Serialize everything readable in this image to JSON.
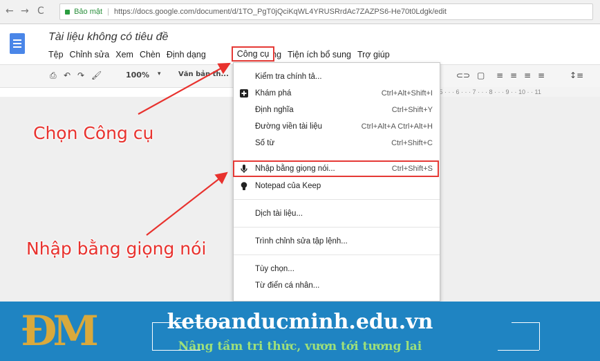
{
  "browser": {
    "security_label": "Bảo mật",
    "url": "https://docs.google.com/document/d/1TO_PgT0jQciKqWL4YRUSRrdAc7ZAZPS6-He70t0Ldgk/edit"
  },
  "doc": {
    "title": "Tài liệu không có tiêu đề"
  },
  "menubar": {
    "items": [
      "Tệp",
      "Chỉnh sửa",
      "Xem",
      "Chèn",
      "Định dạng",
      "Công cụ",
      "Bảng",
      "Tiện ích bổ sung",
      "Trợ giúp"
    ]
  },
  "toolbar": {
    "zoom": "100%",
    "style": "Văn bản th..."
  },
  "ruler": {
    "text": "· 5 · · · 6 · · · 7 · · · 8 · · · 9 · · 10 · · 11"
  },
  "tools_menu": {
    "items": [
      {
        "label": "Kiểm tra chính tả...",
        "shortcut": ""
      },
      {
        "label": "Khám phá",
        "shortcut": "Ctrl+Alt+Shift+I",
        "icon": "explore-icon"
      },
      {
        "label": "Định nghĩa",
        "shortcut": "Ctrl+Shift+Y"
      },
      {
        "label": "Đường viền tài liệu",
        "shortcut": "Ctrl+Alt+A Ctrl+Alt+H"
      },
      {
        "label": "Số từ",
        "shortcut": "Ctrl+Shift+C"
      },
      {
        "label": "Nhập bằng giọng nói...",
        "shortcut": "Ctrl+Shift+S",
        "icon": "microphone-icon"
      },
      {
        "label": "Notepad của Keep",
        "shortcut": "",
        "icon": "lightbulb-icon"
      },
      {
        "label": "Dịch tài liệu...",
        "shortcut": ""
      },
      {
        "label": "Trình chỉnh sửa tập lệnh...",
        "shortcut": ""
      },
      {
        "label": "Tùy chọn...",
        "shortcut": ""
      },
      {
        "label": "Từ điển cá nhân...",
        "shortcut": ""
      }
    ]
  },
  "annotations": {
    "choose_tools": "Chọn Công cụ",
    "voice_typing": "Nhập bằng giọng nói"
  },
  "banner": {
    "logo_text": "ĐM",
    "site": "ketoanducminh.edu.vn",
    "slogan": "Nâng tầm tri thức, vươn tới tương lai"
  },
  "colors": {
    "accent_red": "#e53935",
    "banner_blue": "#1f84c2",
    "docs_blue": "#4a86e8",
    "slogan_green": "#9ee07a",
    "logo_gold": "#d9a93c"
  }
}
